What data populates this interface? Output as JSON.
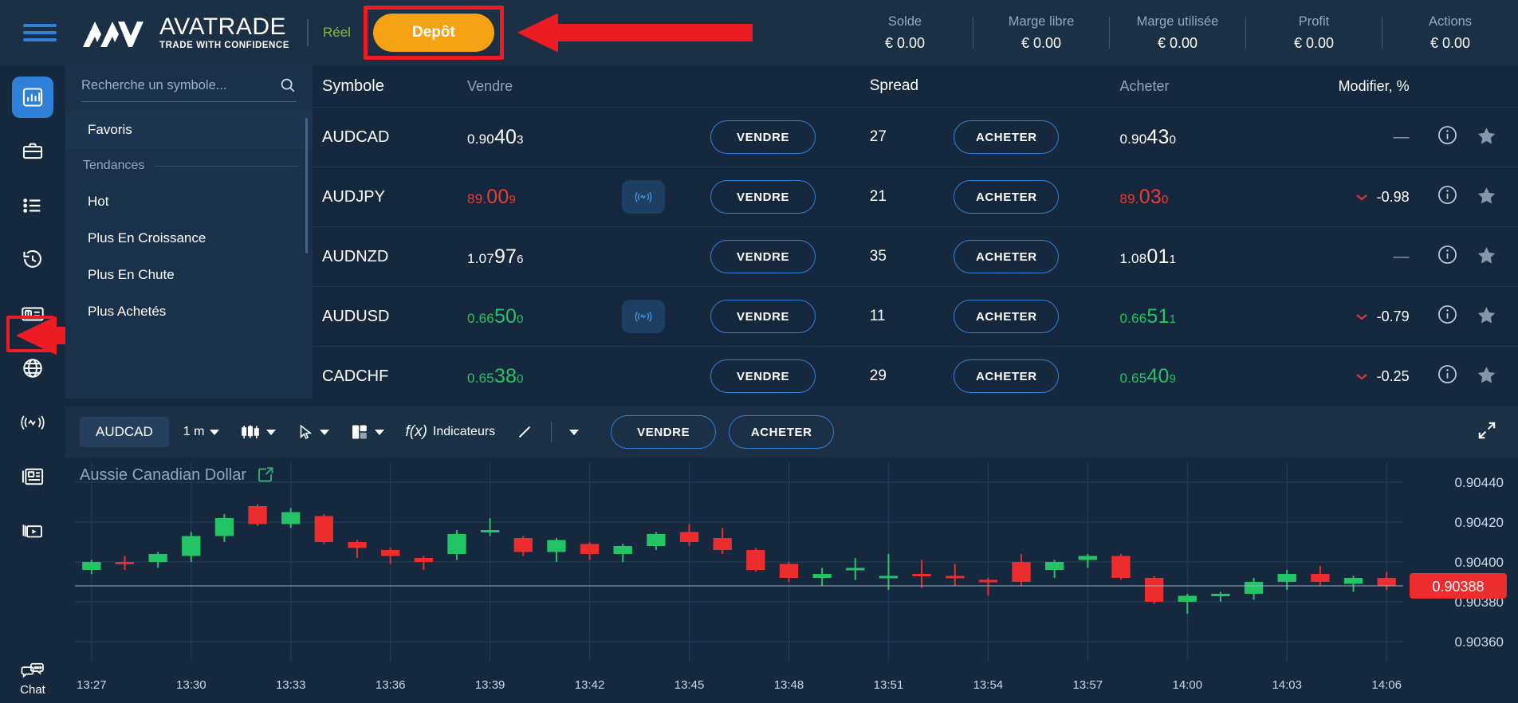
{
  "brand": {
    "name": "AVATRADE",
    "tagline": "TRADE WITH CONFIDENCE",
    "account_type": "Réel",
    "deposit_label": "Depôt",
    "accent_orange": "#f5a214",
    "accent_blue": "#2f80d8",
    "highlight_red": "#ed1c24"
  },
  "stats": [
    {
      "label": "Solde",
      "value": "€ 0.00"
    },
    {
      "label": "Marge libre",
      "value": "€ 0.00"
    },
    {
      "label": "Marge utilisée",
      "value": "€ 0.00"
    },
    {
      "label": "Profit",
      "value": "€ 0.00"
    },
    {
      "label": "Actions",
      "value": "€ 0.00"
    }
  ],
  "rail": [
    {
      "icon": "bar-chart-icon",
      "active": true
    },
    {
      "icon": "briefcase-icon",
      "active": false
    },
    {
      "icon": "list-icon",
      "active": false
    },
    {
      "icon": "history-icon",
      "active": false
    },
    {
      "icon": "payment-check-icon",
      "active": false
    },
    {
      "icon": "globe-icon",
      "active": false
    },
    {
      "icon": "signal-wave-icon",
      "active": false
    },
    {
      "icon": "news-icon",
      "active": false
    },
    {
      "icon": "video-icon",
      "active": false
    }
  ],
  "rail_chat": {
    "label": "Chat",
    "icon": "chat-icon"
  },
  "search": {
    "placeholder": "Recherche un symbole...",
    "value": "",
    "icon": "search-icon",
    "items": [
      {
        "label": "Favoris",
        "type": "item",
        "selected": true
      },
      {
        "label": "Tendances",
        "type": "section"
      },
      {
        "label": "Hot",
        "type": "item"
      },
      {
        "label": "Plus En Croissance",
        "type": "item"
      },
      {
        "label": "Plus En Chute",
        "type": "item"
      },
      {
        "label": "Plus Achetés",
        "type": "item"
      }
    ]
  },
  "quotes": {
    "headers": {
      "symbol": "Symbole",
      "sell": "Vendre",
      "spread": "Spread",
      "buy": "Acheter",
      "change": "Modifier, %"
    },
    "sell_label": "VENDRE",
    "buy_label": "ACHETER",
    "rows": [
      {
        "symbol": "AUDCAD",
        "sell": {
          "pre": "0.90",
          "mid": "40",
          "post": "3",
          "dir": "neutral"
        },
        "signal": false,
        "spread": "27",
        "buy": {
          "pre": "0.90",
          "mid": "43",
          "post": "0",
          "dir": "neutral"
        },
        "change": "—",
        "change_dir": "flat"
      },
      {
        "symbol": "AUDJPY",
        "sell": {
          "pre": "89.",
          "mid": "00",
          "post": "9",
          "dir": "down"
        },
        "signal": true,
        "spread": "21",
        "buy": {
          "pre": "89.",
          "mid": "03",
          "post": "0",
          "dir": "down"
        },
        "change": "-0.98",
        "change_dir": "down"
      },
      {
        "symbol": "AUDNZD",
        "sell": {
          "pre": "1.07",
          "mid": "97",
          "post": "6",
          "dir": "neutral"
        },
        "signal": false,
        "spread": "35",
        "buy": {
          "pre": "1.08",
          "mid": "01",
          "post": "1",
          "dir": "neutral"
        },
        "change": "—",
        "change_dir": "flat"
      },
      {
        "symbol": "AUDUSD",
        "sell": {
          "pre": "0.66",
          "mid": "50",
          "post": "0",
          "dir": "up"
        },
        "signal": true,
        "spread": "11",
        "buy": {
          "pre": "0.66",
          "mid": "51",
          "post": "1",
          "dir": "up"
        },
        "change": "-0.79",
        "change_dir": "down"
      },
      {
        "symbol": "CADCHF",
        "sell": {
          "pre": "0.65",
          "mid": "38",
          "post": "0",
          "dir": "up"
        },
        "signal": false,
        "spread": "29",
        "buy": {
          "pre": "0.65",
          "mid": "40",
          "post": "9",
          "dir": "up"
        },
        "change": "-0.25",
        "change_dir": "down"
      }
    ]
  },
  "chart_toolbar": {
    "symbol": "AUDCAD",
    "timeframe": "1 m",
    "chart_type_icon": "candlestick-icon",
    "cursor_icon": "cursor-icon",
    "layout_icon": "layout-icon",
    "indicators_label": "Indicateurs",
    "indicators_prefix": "f(x)",
    "drawing_icon": "trendline-icon",
    "sell_label": "VENDRE",
    "buy_label": "ACHETER",
    "expand_icon": "expand-icon"
  },
  "chart_data": {
    "type": "candlestick",
    "title": "Aussie Canadian Dollar",
    "symbol": "AUDCAD",
    "interval": "1 m",
    "xlabel": "",
    "ylabel": "",
    "grid": true,
    "legend": "none",
    "current_price": "0.90388",
    "current_price_color": "#ec2d2d",
    "up_color": "#23c466",
    "down_color": "#ec2d2d",
    "ylim": [
      0.9035,
      0.9045
    ],
    "y_ticks": [
      "0.90440",
      "0.90420",
      "0.90400",
      "0.90380",
      "0.90360"
    ],
    "y_tick_values": [
      0.9044,
      0.9042,
      0.904,
      0.9038,
      0.9036
    ],
    "x_ticks": [
      "13:27",
      "13:30",
      "13:33",
      "13:36",
      "13:39",
      "13:42",
      "13:45",
      "13:48",
      "13:51",
      "13:54",
      "13:57",
      "14:00",
      "14:03",
      "14:06"
    ],
    "candles": [
      {
        "t": "13:27",
        "o": 0.90396,
        "h": 0.90401,
        "l": 0.90394,
        "c": 0.904
      },
      {
        "t": "13:28",
        "o": 0.904,
        "h": 0.90403,
        "l": 0.90396,
        "c": 0.90399
      },
      {
        "t": "13:29",
        "o": 0.904,
        "h": 0.90405,
        "l": 0.90397,
        "c": 0.90404
      },
      {
        "t": "13:30",
        "o": 0.90403,
        "h": 0.90415,
        "l": 0.904,
        "c": 0.90413
      },
      {
        "t": "13:31",
        "o": 0.90413,
        "h": 0.90424,
        "l": 0.9041,
        "c": 0.90422
      },
      {
        "t": "13:32",
        "o": 0.90428,
        "h": 0.90429,
        "l": 0.90418,
        "c": 0.90419
      },
      {
        "t": "13:33",
        "o": 0.90419,
        "h": 0.90427,
        "l": 0.90417,
        "c": 0.90425
      },
      {
        "t": "13:34",
        "o": 0.90423,
        "h": 0.90424,
        "l": 0.90409,
        "c": 0.9041
      },
      {
        "t": "13:35",
        "o": 0.9041,
        "h": 0.90411,
        "l": 0.90402,
        "c": 0.90407
      },
      {
        "t": "13:36",
        "o": 0.90406,
        "h": 0.90407,
        "l": 0.90399,
        "c": 0.90403
      },
      {
        "t": "13:37",
        "o": 0.90402,
        "h": 0.90403,
        "l": 0.90396,
        "c": 0.904
      },
      {
        "t": "13:38",
        "o": 0.90404,
        "h": 0.90416,
        "l": 0.90401,
        "c": 0.90414
      },
      {
        "t": "13:39",
        "o": 0.90416,
        "h": 0.90422,
        "l": 0.90413,
        "c": 0.90416
      },
      {
        "t": "13:40",
        "o": 0.90412,
        "h": 0.90413,
        "l": 0.90403,
        "c": 0.90405
      },
      {
        "t": "13:41",
        "o": 0.90405,
        "h": 0.90412,
        "l": 0.904,
        "c": 0.90411
      },
      {
        "t": "13:42",
        "o": 0.90409,
        "h": 0.9041,
        "l": 0.90401,
        "c": 0.90404
      },
      {
        "t": "13:43",
        "o": 0.90404,
        "h": 0.90409,
        "l": 0.904,
        "c": 0.90408
      },
      {
        "t": "13:44",
        "o": 0.90408,
        "h": 0.90415,
        "l": 0.90406,
        "c": 0.90414
      },
      {
        "t": "13:45",
        "o": 0.90415,
        "h": 0.90419,
        "l": 0.90408,
        "c": 0.9041
      },
      {
        "t": "13:46",
        "o": 0.90412,
        "h": 0.90417,
        "l": 0.90404,
        "c": 0.90406
      },
      {
        "t": "13:47",
        "o": 0.90406,
        "h": 0.90407,
        "l": 0.90395,
        "c": 0.90396
      },
      {
        "t": "13:48",
        "o": 0.90399,
        "h": 0.904,
        "l": 0.9039,
        "c": 0.90392
      },
      {
        "t": "13:49",
        "o": 0.90392,
        "h": 0.90397,
        "l": 0.90388,
        "c": 0.90394
      },
      {
        "t": "13:50",
        "o": 0.90396,
        "h": 0.90402,
        "l": 0.90391,
        "c": 0.90397
      },
      {
        "t": "13:51",
        "o": 0.90393,
        "h": 0.90404,
        "l": 0.90386,
        "c": 0.90393
      },
      {
        "t": "13:52",
        "o": 0.90394,
        "h": 0.90401,
        "l": 0.90387,
        "c": 0.90393
      },
      {
        "t": "13:53",
        "o": 0.90393,
        "h": 0.90399,
        "l": 0.90388,
        "c": 0.90392
      },
      {
        "t": "13:54",
        "o": 0.90391,
        "h": 0.90392,
        "l": 0.90383,
        "c": 0.9039
      },
      {
        "t": "13:55",
        "o": 0.904,
        "h": 0.90404,
        "l": 0.90388,
        "c": 0.9039
      },
      {
        "t": "13:56",
        "o": 0.90396,
        "h": 0.90401,
        "l": 0.90392,
        "c": 0.904
      },
      {
        "t": "13:57",
        "o": 0.90401,
        "h": 0.90404,
        "l": 0.90397,
        "c": 0.90403
      },
      {
        "t": "13:58",
        "o": 0.90403,
        "h": 0.90404,
        "l": 0.90391,
        "c": 0.90392
      },
      {
        "t": "13:59",
        "o": 0.90392,
        "h": 0.90393,
        "l": 0.90379,
        "c": 0.9038
      },
      {
        "t": "14:00",
        "o": 0.9038,
        "h": 0.90384,
        "l": 0.90374,
        "c": 0.90383
      },
      {
        "t": "14:01",
        "o": 0.90383,
        "h": 0.90385,
        "l": 0.9038,
        "c": 0.90384
      },
      {
        "t": "14:02",
        "o": 0.90384,
        "h": 0.90392,
        "l": 0.90381,
        "c": 0.9039
      },
      {
        "t": "14:03",
        "o": 0.9039,
        "h": 0.90396,
        "l": 0.90386,
        "c": 0.90394
      },
      {
        "t": "14:04",
        "o": 0.90394,
        "h": 0.90398,
        "l": 0.90388,
        "c": 0.9039
      },
      {
        "t": "14:05",
        "o": 0.90389,
        "h": 0.90393,
        "l": 0.90385,
        "c": 0.90392
      },
      {
        "t": "14:06",
        "o": 0.90392,
        "h": 0.90395,
        "l": 0.90386,
        "c": 0.90388
      }
    ]
  }
}
